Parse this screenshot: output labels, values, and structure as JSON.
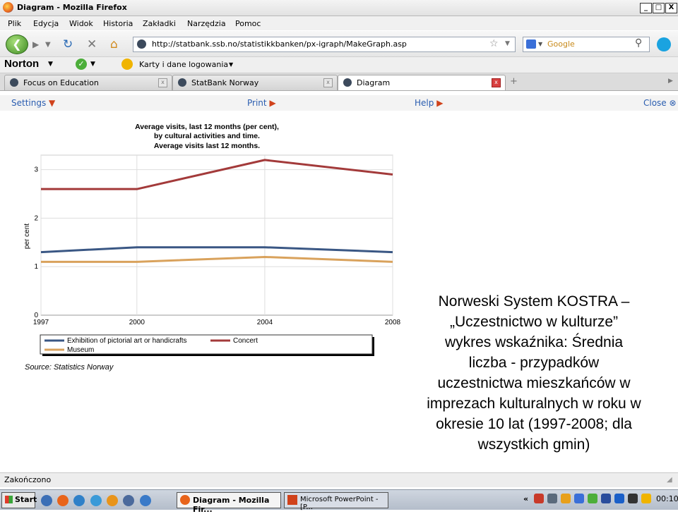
{
  "window": {
    "title": "Diagram - Mozilla Firefox",
    "controls": [
      "_",
      "□",
      "X"
    ]
  },
  "menu": [
    "Plik",
    "Edycja",
    "Widok",
    "Historia",
    "Zakładki",
    "Narzędzia",
    "Pomoc"
  ],
  "nav": {
    "url": "http://statbank.ssb.no/statistikkbanken/px-igraph/MakeGraph.asp",
    "search_placeholder": "Google"
  },
  "norton": {
    "label": "Norton",
    "cards": "Karty i dane logowania"
  },
  "tabs": [
    {
      "label": "Focus on Education",
      "active": false
    },
    {
      "label": "StatBank Norway",
      "active": false
    },
    {
      "label": "Diagram",
      "active": true
    }
  ],
  "page_toolbar": {
    "settings": "Settings",
    "print": "Print",
    "help": "Help",
    "close": "Close"
  },
  "chart_data": {
    "type": "line",
    "title_lines": [
      "Average visits, last 12 months (per cent),",
      "by cultural activities and time.",
      "Average visits last 12 months."
    ],
    "ylabel": "per cent",
    "x": [
      "1997",
      "2000",
      "2004",
      "2008"
    ],
    "yticks": [
      "0",
      "1",
      "2",
      "3"
    ],
    "ylim": [
      0,
      3.3
    ],
    "grid": true,
    "legend_position": "bottom",
    "series": [
      {
        "name": "Exhibition of pictorial art or handicrafts",
        "color": "#3a5784",
        "values": [
          1.3,
          1.4,
          1.4,
          1.3
        ]
      },
      {
        "name": "Concert",
        "color": "#a33a3a",
        "values": [
          2.6,
          2.6,
          3.2,
          2.9
        ]
      },
      {
        "name": "Museum",
        "color": "#d9a25c",
        "values": [
          1.1,
          1.1,
          1.2,
          1.1
        ]
      }
    ],
    "source": "Source: Statistics Norway"
  },
  "overlay_lines": [
    "Norweski System KOSTRA –",
    "„Uczestnictwo w kulturze”",
    "wykres wskaźnika: Średnia",
    "liczba - przypadków",
    "uczestnictwa mieszkańców w",
    "imprezach kulturalnych w roku w",
    "okresie 10 lat (1997-2008; dla",
    "wszystkich gmin)"
  ],
  "status": "Zakończono",
  "taskbar": {
    "start": "Start",
    "buttons": [
      "Diagram - Mozilla Fir...",
      "Microsoft PowerPoint - [P..."
    ],
    "clock": "00:10",
    "chevron": "«"
  }
}
